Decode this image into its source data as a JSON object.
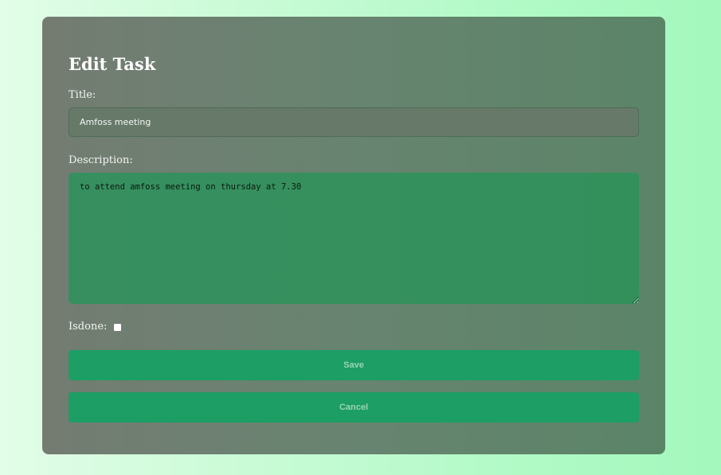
{
  "form": {
    "heading": "Edit Task",
    "title_label": "Title:",
    "title_value": "Amfoss meeting",
    "description_label": "Description:",
    "description_value": "to attend amfoss meeting on thursday at 7.30",
    "isdone_label": "Isdone:",
    "isdone_checked": false,
    "save_label": "Save",
    "cancel_label": "Cancel"
  },
  "colors": {
    "button": "#1c9e65",
    "textarea": "#33905b"
  }
}
